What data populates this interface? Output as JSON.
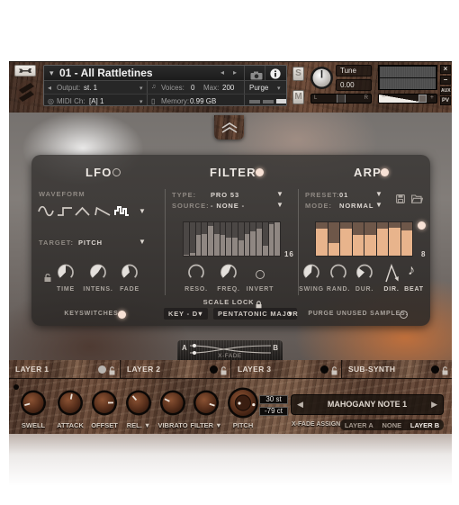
{
  "header": {
    "title": "01 - All Rattletines",
    "output": {
      "label": "Output:",
      "value": "st. 1"
    },
    "midi": {
      "label": "MIDI Ch:",
      "value": "[A] 1"
    },
    "voices": {
      "label": "Voices:",
      "value": "0"
    },
    "max": {
      "label": "Max:",
      "value": "200"
    },
    "memory": {
      "label": "Memory:",
      "value": "0.99 GB"
    },
    "purge": "Purge",
    "solo": "S",
    "mute": "M",
    "tune": {
      "label": "Tune",
      "value": "0.00"
    },
    "pan": {
      "left": "L",
      "right": "R",
      "value": 0.5
    },
    "volume": {
      "minus": "−",
      "plus": "+",
      "value": 0.8
    },
    "side_buttons": {
      "close": "×",
      "minimize": "−",
      "aux": "AUX",
      "pv": "PV"
    },
    "glyphs": {
      "caret": "▾",
      "prev": "◂",
      "next": "▸"
    }
  },
  "lfo": {
    "title": "LFO",
    "enabled": false,
    "waveform_label": "WAVEFORM",
    "waveforms": [
      "sine",
      "square",
      "triangle",
      "saw",
      "random"
    ],
    "selected_waveform": "random",
    "target_label": "TARGET:",
    "target_value": "PITCH",
    "knobs": [
      {
        "label": "TIME",
        "value": 0.5
      },
      {
        "label": "INTENS.",
        "value": 0.62
      },
      {
        "label": "FADE",
        "value": 0.45
      }
    ],
    "keyswitches_label": "KEYSWITCHES:",
    "keyswitches_on": true
  },
  "filter": {
    "title": "FILTER",
    "enabled": true,
    "type_label": "TYPE:",
    "type_value": "PRO 53",
    "source_label": "SOURCE:",
    "source_value": "- NONE -",
    "steps": [
      0.04,
      0.09,
      0.63,
      0.66,
      0.88,
      0.64,
      0.61,
      0.55,
      0.54,
      0.46,
      0.66,
      0.73,
      0.82,
      0.31,
      0.95,
      1.0
    ],
    "step_count": "16",
    "knobs": [
      {
        "label": "RESO.",
        "value": 0
      },
      {
        "label": "FREQ.",
        "value": 0.58
      }
    ],
    "invert_label": "INVERT",
    "invert_on": false
  },
  "scale_lock": {
    "label": "SCALE LOCK",
    "key": "KEY - D",
    "scale": "PENTATONIC MAJOR"
  },
  "arp": {
    "title": "ARP",
    "enabled": true,
    "preset_label": "PRESET:",
    "preset_value": "01",
    "mode_label": "MODE:",
    "mode_value": "NORMAL",
    "steps": [
      0.8,
      0.38,
      0.8,
      0.62,
      0.62,
      0.8,
      0.85,
      0.75
    ],
    "step_count": "8",
    "knobs": [
      {
        "label": "SWING",
        "value": 0.52
      },
      {
        "label": "RAND.",
        "value": 0
      },
      {
        "label": "DUR.",
        "value": 0.3
      }
    ],
    "dir_label": "DIR.",
    "beat_label": "BEAT",
    "beat_glyph": "♪",
    "purge_label": "PURGE UNUSED SAMPLES:",
    "purge_on": false
  },
  "xfade": {
    "label": "X-FADE",
    "a": "A",
    "b": "B"
  },
  "layers": [
    {
      "label": "LAYER 1",
      "active": true
    },
    {
      "label": "LAYER 2",
      "active": false
    },
    {
      "label": "LAYER 3",
      "active": false
    },
    {
      "label": "SUB-SYNTH",
      "active": false
    }
  ],
  "bottom": {
    "knobs": [
      {
        "label": "SWELL",
        "value": 0.11
      },
      {
        "label": "ATTACK",
        "value": 0.54
      },
      {
        "label": "OFFSET",
        "value": 0.83
      },
      {
        "label": "REL.",
        "value": 0.35
      },
      {
        "label": "VIBRATO",
        "value": 0.26
      },
      {
        "label": "FILTER",
        "value": 0.9
      }
    ],
    "dropdown_glyph": "▼",
    "pitch": {
      "label": "PITCH",
      "value": 0.87,
      "semitones": "30 st",
      "cents": "-79 ct"
    },
    "preset_name": "MAHOGANY NOTE 1",
    "preset_prev": "◀",
    "preset_next": "▶",
    "xfade_assign_label": "X-FADE ASSIGN",
    "xfade_assign_options": [
      "LAYER A",
      "NONE",
      "LAYER B"
    ],
    "xfade_assign_selected": "LAYER B"
  },
  "dropdown_glyph": "▼"
}
